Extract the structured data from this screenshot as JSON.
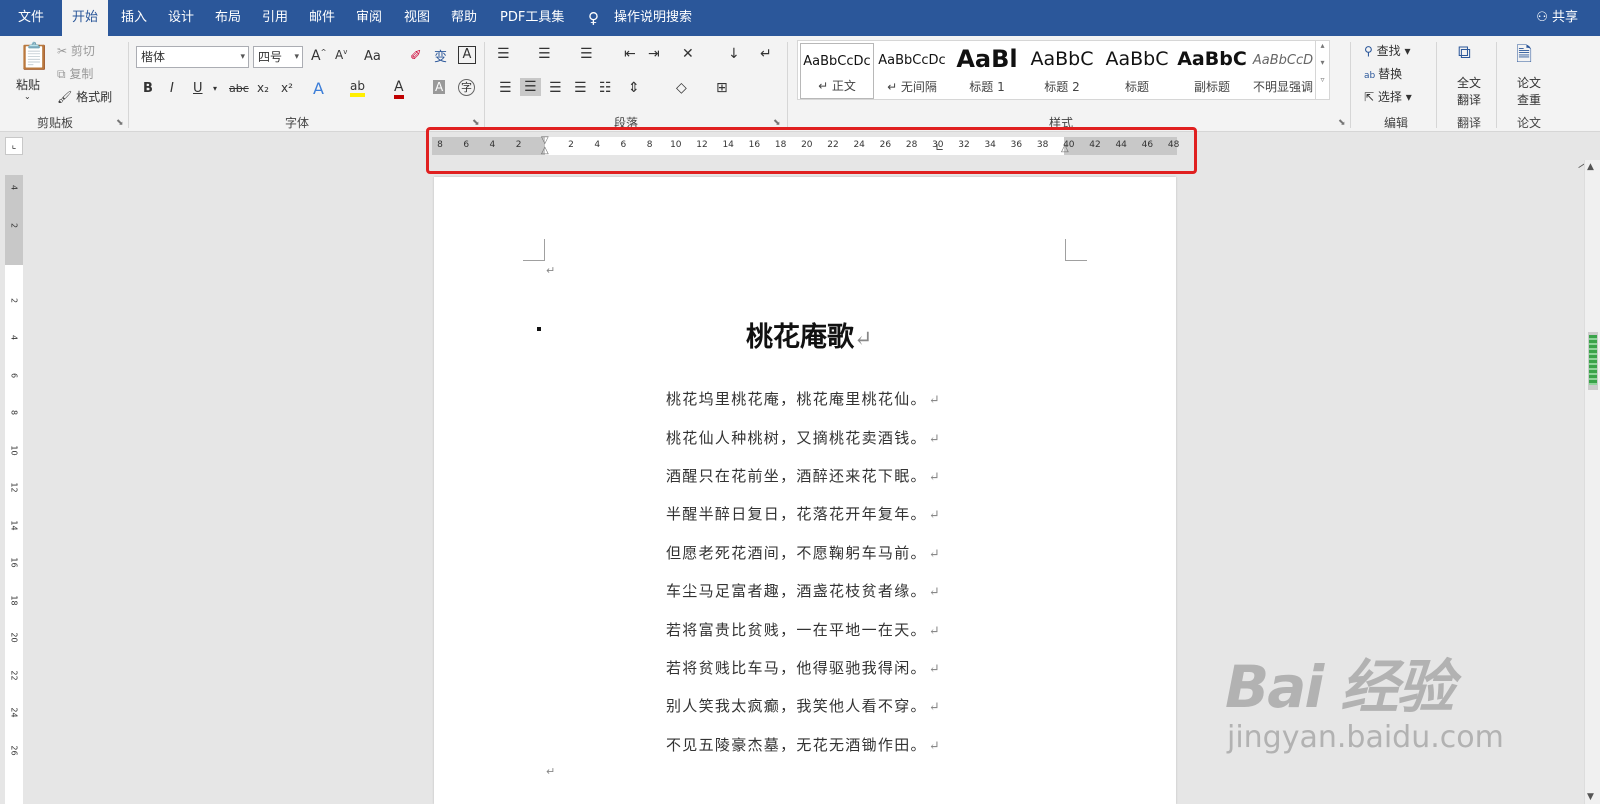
{
  "menu": {
    "tabs": [
      {
        "label": "文件"
      },
      {
        "label": "开始"
      },
      {
        "label": "插入"
      },
      {
        "label": "设计"
      },
      {
        "label": "布局"
      },
      {
        "label": "引用"
      },
      {
        "label": "邮件"
      },
      {
        "label": "审阅"
      },
      {
        "label": "视图"
      },
      {
        "label": "帮助"
      },
      {
        "label": "PDF工具集"
      }
    ],
    "active_tab": "开始",
    "search_label": "操作说明搜索",
    "share_label": "共享"
  },
  "ribbon": {
    "clipboard": {
      "group_label": "剪贴板",
      "paste_label": "粘贴",
      "cut_label": "剪切",
      "copy_label": "复制",
      "format_painter_label": "格式刷"
    },
    "font": {
      "group_label": "字体",
      "font_name": "楷体",
      "font_size": "四号",
      "change_case": "Aa",
      "bold": "B",
      "italic": "I",
      "underline": "U",
      "strikethrough": "abc",
      "subscript": "x₂",
      "superscript": "x²"
    },
    "paragraph": {
      "group_label": "段落"
    },
    "styles": {
      "group_label": "样式",
      "items": [
        {
          "sample": "AaBbCcDc",
          "name": "↵ 正文"
        },
        {
          "sample": "AaBbCcDc",
          "name": "↵ 无间隔"
        },
        {
          "sample": "AaBl",
          "name": "标题 1"
        },
        {
          "sample": "AaBbC",
          "name": "标题 2"
        },
        {
          "sample": "AaBbC",
          "name": "标题"
        },
        {
          "sample": "AaBbC",
          "name": "副标题"
        },
        {
          "sample": "AaBbCcD",
          "name": "不明显强调"
        }
      ]
    },
    "editing": {
      "group_label": "编辑",
      "find_label": "查找",
      "replace_label": "替换",
      "select_label": "选择"
    },
    "translate": {
      "group_label": "翻译",
      "button_label_1": "全文",
      "button_label_2": "翻译"
    },
    "paper": {
      "group_label": "论文",
      "button_label_1": "论文",
      "button_label_2": "查重"
    }
  },
  "ruler": {
    "ticks": [
      "8",
      "6",
      "4",
      "2",
      "",
      "2",
      "4",
      "6",
      "8",
      "10",
      "12",
      "14",
      "16",
      "18",
      "20",
      "22",
      "24",
      "26",
      "28",
      "30",
      "32",
      "34",
      "36",
      "38",
      "40",
      "42",
      "44",
      "46",
      "48"
    ],
    "vertical_ticks": [
      "4",
      "2",
      "",
      "2",
      "4",
      "6",
      "8",
      "10",
      "12",
      "14",
      "16",
      "18",
      "20",
      "22",
      "24",
      "26"
    ]
  },
  "document": {
    "title": "桃花庵歌",
    "lines": [
      "桃花坞里桃花庵，桃花庵里桃花仙。",
      "桃花仙人种桃树，又摘桃花卖酒钱。",
      "酒醒只在花前坐，酒醉还来花下眠。",
      "半醒半醉日复日，花落花开年复年。",
      "但愿老死花酒间，不愿鞠躬车马前。",
      "车尘马足富者趣，酒盏花枝贫者缘。",
      "若将富贵比贫贱，一在平地一在天。",
      "若将贫贱比车马，他得驱驰我得闲。",
      "别人笑我太疯癫，我笑他人看不穿。",
      "不见五陵豪杰墓，无花无酒锄作田。"
    ],
    "paragraph_mark": "↵"
  },
  "watermark": {
    "main": "Bai 经验",
    "sub": "jingyan.baidu.com"
  },
  "colors": {
    "menubar": "#2b579a",
    "highlight": "#e02020"
  }
}
